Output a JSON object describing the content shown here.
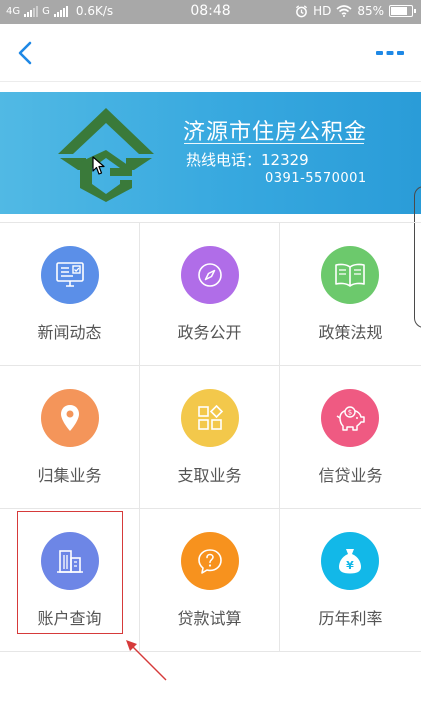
{
  "status_bar": {
    "net1": "4G",
    "net2": "G",
    "speed": "0.6K/s",
    "time": "08:48",
    "hd": "HD",
    "battery": "85%",
    "battery_level": 0.85
  },
  "nav": {
    "back_icon": "chevron-left-icon",
    "more_icon": "more-dots-icon",
    "accent": "#1e88e5"
  },
  "banner": {
    "title": "济源市住房公积金",
    "hotline": "热线电话：12329",
    "phone": "0391-5570001",
    "bg": "#3aabe0",
    "logo_color": "#3a7a3a"
  },
  "menu": [
    {
      "label": "新闻动态",
      "icon": "monitor-checklist-icon",
      "color": "#5b8fe8"
    },
    {
      "label": "政务公开",
      "icon": "compass-icon",
      "color": "#b06de8"
    },
    {
      "label": "政策法规",
      "icon": "book-icon",
      "color": "#6cc96c"
    },
    {
      "label": "归集业务",
      "icon": "location-pin-icon",
      "color": "#f4955a"
    },
    {
      "label": "支取业务",
      "icon": "apps-grid-icon",
      "color": "#f3c84b"
    },
    {
      "label": "信贷业务",
      "icon": "piggy-bank-icon",
      "color": "#ef5a82"
    },
    {
      "label": "账户查询",
      "icon": "building-icon",
      "color": "#6d86e6"
    },
    {
      "label": "贷款试算",
      "icon": "question-chat-icon",
      "color": "#f7921e"
    },
    {
      "label": "历年利率",
      "icon": "money-bag-icon",
      "color": "#12b8e8"
    }
  ]
}
